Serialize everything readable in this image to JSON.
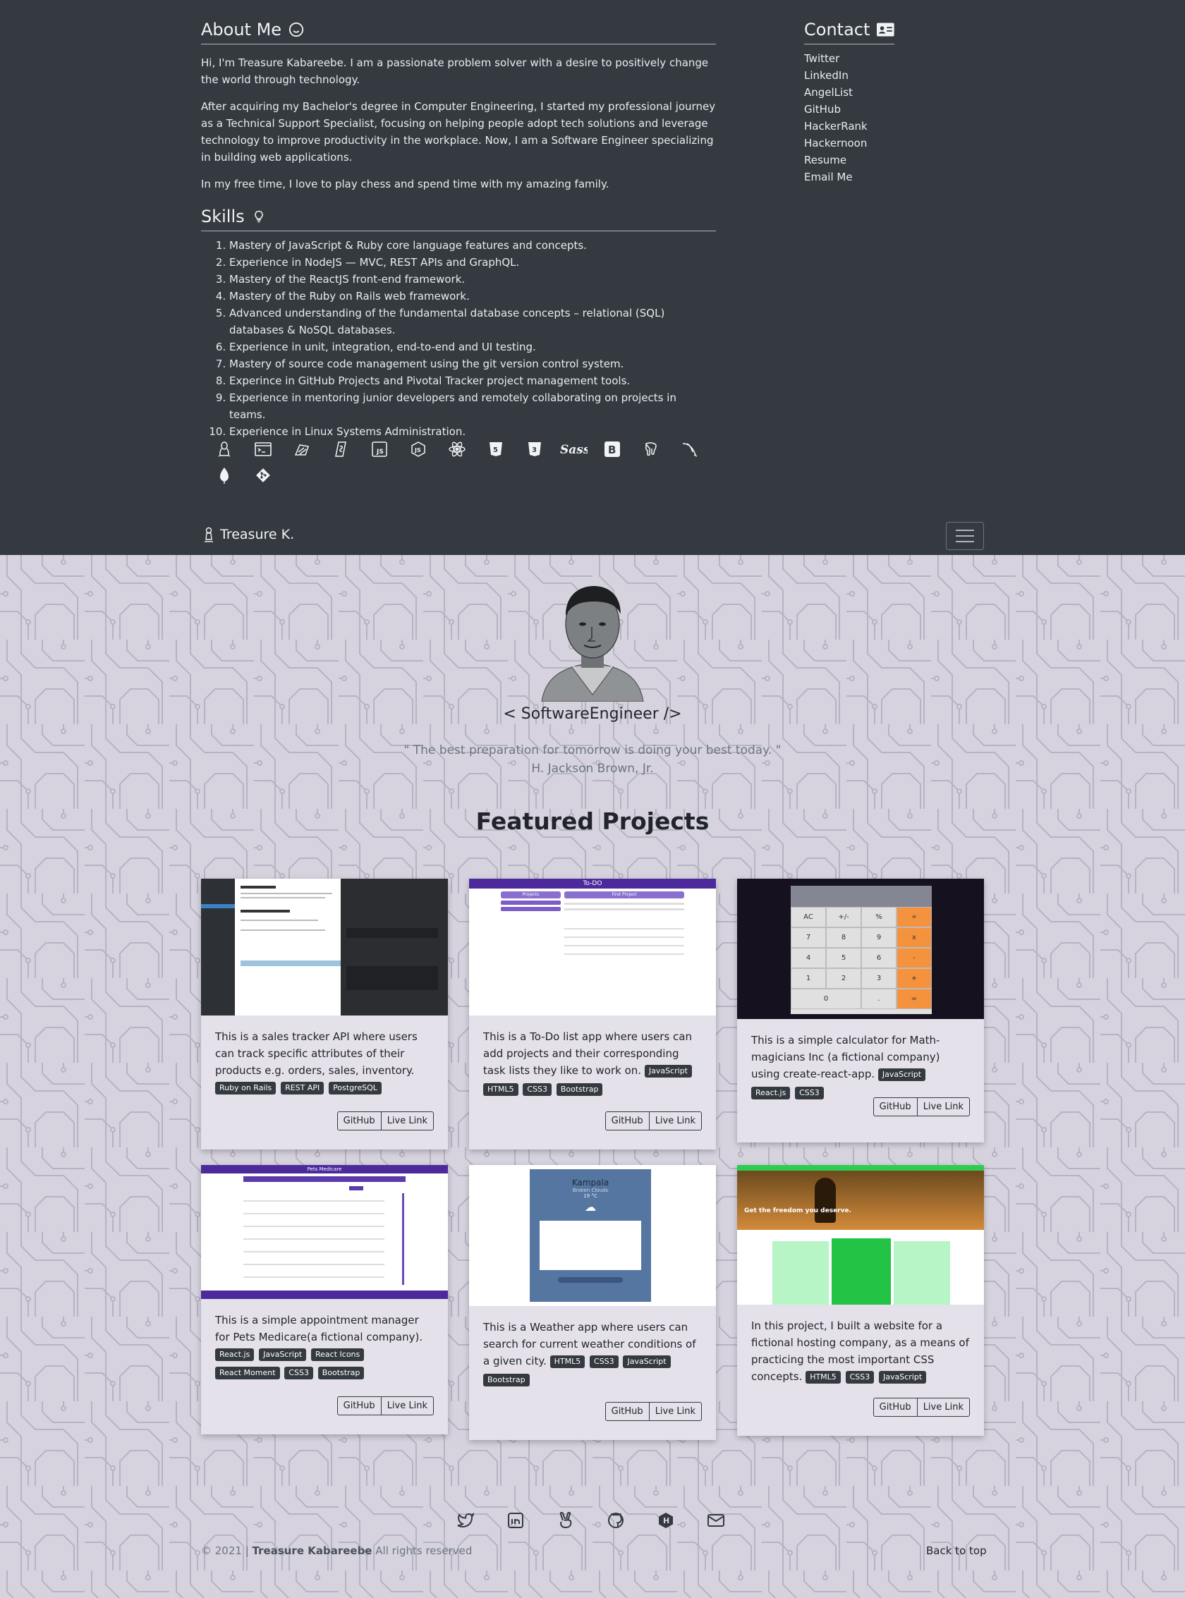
{
  "about": {
    "title": "About Me",
    "paragraphs": [
      "Hi, I'm Treasure Kabareebe. I am a passionate problem solver with a desire to positively change the world through technology.",
      "After acquiring my Bachelor's degree in Computer Engineering, I started my professional journey as a Technical Support Specialist, focusing on helping people adopt tech solutions and leverage technology to improve productivity in the workplace. Now, I am a Software Engineer specializing in building web applications.",
      "In my free time, I love to play chess and spend time with my amazing family."
    ]
  },
  "skills": {
    "title": "Skills",
    "items": [
      "Mastery of JavaScript & Ruby core language features and concepts.",
      "Experience in NodeJS — MVC, REST APIs and GraphQL.",
      "Mastery of the ReactJS front-end framework.",
      "Mastery of the Ruby on Rails web framework.",
      "Advanced understanding of the fundamental database concepts – relational (SQL) databases & NoSQL databases.",
      "Experience in unit, integration, end-to-end and UI testing.",
      "Mastery of source code management using the git version control system.",
      "Experince in GitHub Projects and Pivotal Tracker project management tools.",
      "Experience in mentoring junior developers and remotely collaborating on projects in teams.",
      "Experience in Linux Systems Administration."
    ],
    "tech_icons": [
      "linux-icon",
      "terminal-icon",
      "debian-icon",
      "bash-icon",
      "javascript-icon",
      "nodejs-icon",
      "react-icon",
      "html5-icon",
      "css3-icon",
      "sass-icon",
      "bootstrap-icon",
      "postgresql-icon",
      "mysql-icon",
      "mongodb-icon",
      "git-icon"
    ]
  },
  "contact": {
    "title": "Contact",
    "links": [
      "Twitter",
      "LinkedIn",
      "AngelList",
      "GitHub",
      "HackerRank",
      "Hackernoon",
      "Resume",
      "Email Me"
    ]
  },
  "navbar": {
    "brand": "Treasure K."
  },
  "hero": {
    "role": "< SoftwareEngineer />",
    "quote": "\" The best preparation for tomorrow is doing your best today. \"",
    "author": "H. Jackson Brown, Jr."
  },
  "featured": {
    "title": "Featured Projects",
    "github_label": "GitHub",
    "live_label": "Live Link",
    "projects": [
      {
        "text": "This is a sales tracker API where users can track specific attributes of their products e.g. orders, sales, inventory.",
        "tags": [
          "Ruby on Rails",
          "REST API",
          "PostgreSQL"
        ]
      },
      {
        "text": "This is a To-Do list app where users can add projects and their corresponding task lists they like to work on.",
        "tags": [
          "JavaScript",
          "HTML5",
          "CSS3",
          "Bootstrap"
        ],
        "shot": {
          "title": "To-DO",
          "projects": "Projects",
          "first": "First Project"
        }
      },
      {
        "text": "This is a simple calculator for Math-magicians Inc (a fictional company) using create-react-app.",
        "tags": [
          "JavaScript",
          "React.js",
          "CSS3"
        ],
        "shot": {
          "keys": [
            "AC",
            "+/-",
            "%",
            "÷",
            "7",
            "8",
            "9",
            "x",
            "4",
            "5",
            "6",
            "-",
            "1",
            "2",
            "3",
            "+",
            "0",
            ".",
            "="
          ]
        }
      },
      {
        "text": "This is a simple appointment manager for Pets Medicare(a fictional company).",
        "tags": [
          "React.js",
          "JavaScript",
          "React Icons",
          "React Moment",
          "CSS3",
          "Bootstrap"
        ],
        "shot": {
          "title": "Pets Medicare"
        }
      },
      {
        "text": "This is a Weather app where users can search for current weather conditions of a given city.",
        "tags": [
          "HTML5",
          "CSS3",
          "JavaScript",
          "Bootstrap"
        ],
        "shot": {
          "city": "Kampala",
          "cond": "Broken Clouds",
          "temp": "19 °C"
        }
      },
      {
        "text": "In this project, I built a website for a fictional hosting company, as a means of practicing the most important CSS concepts.",
        "tags": [
          "HTML5",
          "CSS3",
          "JavaScript"
        ],
        "shot": {
          "headline": "Get the freedom you deserve."
        }
      }
    ]
  },
  "footer": {
    "social": [
      "twitter-icon",
      "linkedin-icon",
      "angellist-icon",
      "github-icon",
      "hackerrank-icon",
      "email-icon"
    ],
    "year": "© 2021",
    "name": "Treasure Kabareebe",
    "rights": "All rights reserved",
    "back_to_top": "Back to top"
  }
}
